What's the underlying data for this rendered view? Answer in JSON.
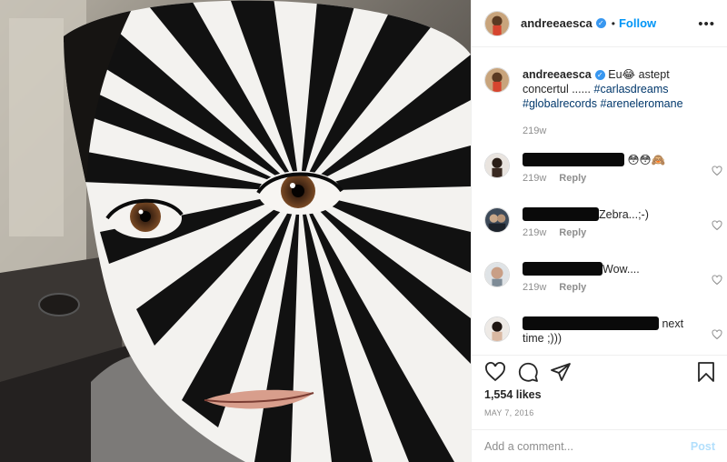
{
  "header": {
    "username": "andreeaesca",
    "verified_icon": "verified-badge-icon",
    "separator": "•",
    "follow_label": "Follow",
    "more_icon": "more-options-icon"
  },
  "caption": {
    "username": "andreeaesca",
    "text_before_emoji": "Eu",
    "emoji": "😂",
    "text_after_emoji": " astept concertul ......",
    "hashtags": [
      "#carlasdreams",
      "#globalrecords",
      "#areneleromane"
    ],
    "time": "219w"
  },
  "comments": [
    {
      "text": "",
      "emojis": "😳😳🙈",
      "time": "219w",
      "reply_label": "Reply"
    },
    {
      "text": "Zebra...;-)",
      "time": "219w",
      "reply_label": "Reply"
    },
    {
      "text": "Wow....",
      "time": "219w",
      "reply_label": "Reply"
    },
    {
      "text": "next time ;)))"
    }
  ],
  "actions": {
    "like_icon": "heart-icon",
    "comment_icon": "comment-icon",
    "share_icon": "share-icon",
    "save_icon": "bookmark-icon",
    "likes": "1,554 likes",
    "date": "MAY 7, 2016"
  },
  "add_comment": {
    "placeholder": "Add a comment...",
    "post_label": "Post"
  },
  "colors": {
    "accent": "#0095f6",
    "hashtag": "#00376b",
    "muted": "#8e8e8e",
    "border": "#efefef",
    "post_disabled": "#b2dffc"
  }
}
